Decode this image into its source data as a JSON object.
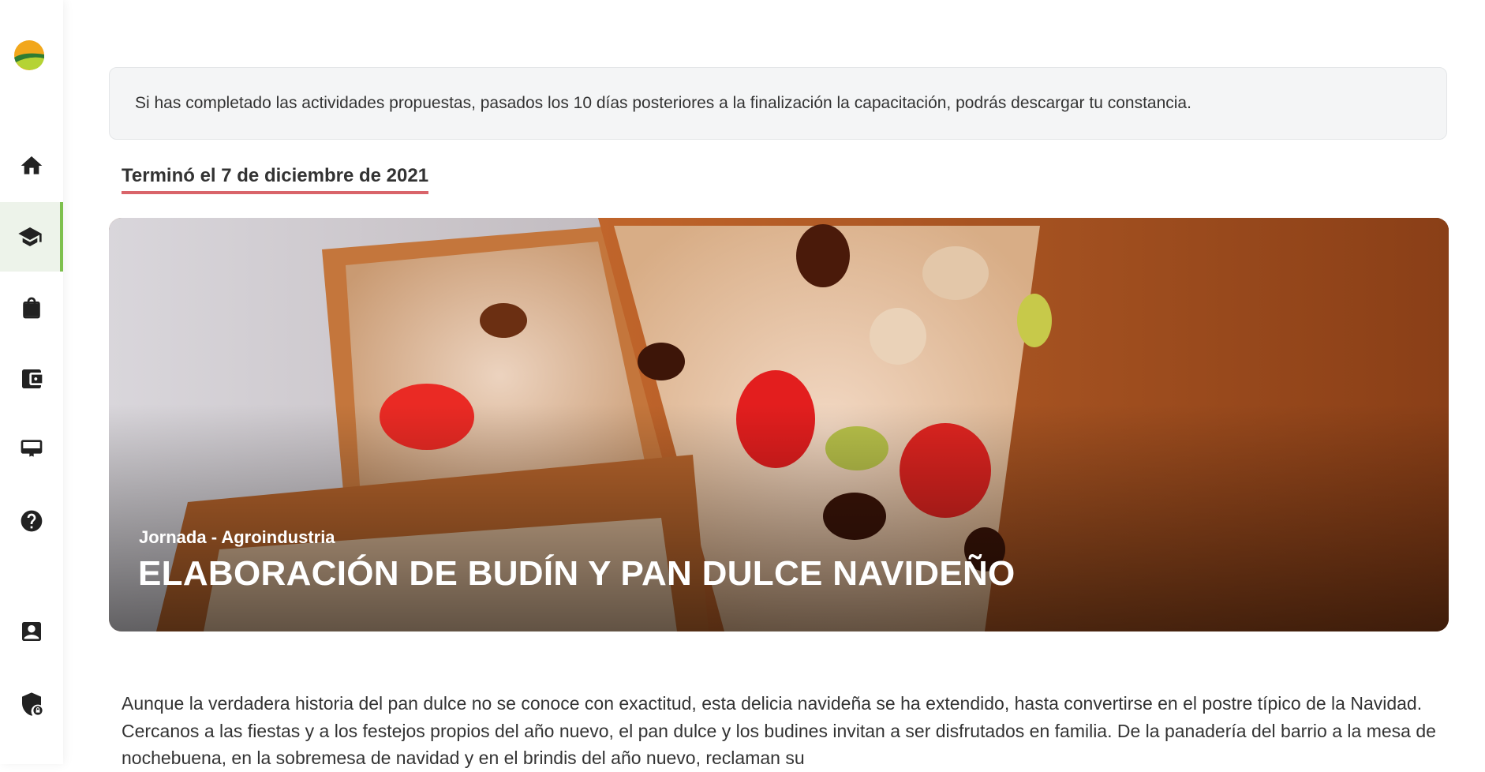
{
  "sidebar": {
    "logo_icon": "app-logo",
    "items": [
      {
        "name": "home",
        "icon": "home-icon"
      },
      {
        "name": "courses",
        "icon": "graduation-cap-icon",
        "active": true
      },
      {
        "name": "shop",
        "icon": "shopping-bag-icon"
      },
      {
        "name": "wallet",
        "icon": "wallet-icon"
      },
      {
        "name": "billboard",
        "icon": "billboard-icon"
      },
      {
        "name": "help",
        "icon": "help-icon"
      },
      {
        "name": "contact",
        "icon": "contact-card-icon"
      },
      {
        "name": "security",
        "icon": "shield-lock-icon"
      }
    ],
    "active_color": "#7ec04e"
  },
  "notice": {
    "text": "Si has completado las actividades propuestas, pasados los 10 días posteriores a la finalización la capacitación, podrás descargar tu constancia."
  },
  "course": {
    "end_date": "Terminó el 7 de diciembre de 2021",
    "category": "Jornada - Agroindustria",
    "title": "ELABORACIÓN DE BUDÍN Y PAN DULCE NAVIDEÑO"
  },
  "description": {
    "text": "Aunque la verdadera historia del pan dulce no se conoce con exactitud, esta delicia navideña se ha extendido, hasta convertirse en el postre típico de la Navidad. Cercanos a las fiestas y a los festejos propios del año nuevo, el pan dulce y los budines invitan a ser disfrutados en familia. De la panadería del barrio a la mesa de nochebuena, en la sobremesa de navidad y en el brindis del año nuevo, reclaman su"
  },
  "colors": {
    "underline": "#d9646a",
    "notice_bg": "#f4f5f6"
  }
}
